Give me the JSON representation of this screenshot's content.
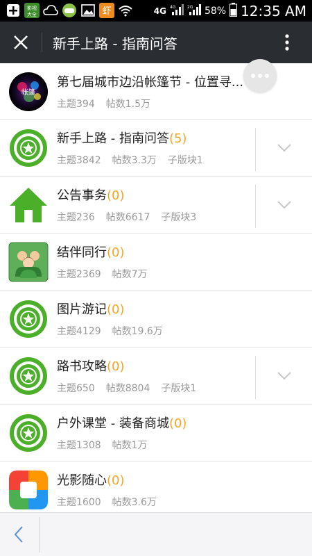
{
  "status_bar": {
    "app_icon_1": "影视大全",
    "signal_label": "4G",
    "network_1": "4G",
    "network_2": "2G",
    "battery": "58%",
    "time": "12:35 AM"
  },
  "header": {
    "title": "新手上路 - 指南问答"
  },
  "forums": [
    {
      "name": "第七届城市边沿帐篷节 - 位置寻...",
      "count": "",
      "topics": "主题394",
      "posts": "帖数1.5万",
      "sub": "",
      "icon": "festival-avatar",
      "expandable": false
    },
    {
      "name": "新手上路 - 指南问答",
      "count": "(5)",
      "topics": "主题3842",
      "posts": "帖数3.3万",
      "sub": "子版块1",
      "icon": "green-star-badge",
      "expandable": true
    },
    {
      "name": "公告事务",
      "count": "(0)",
      "topics": "主题236",
      "posts": "帖数6617",
      "sub": "子版块3",
      "icon": "green-house",
      "expandable": true
    },
    {
      "name": "结伴同行",
      "count": "(0)",
      "topics": "主题2369",
      "posts": "帖数7万",
      "sub": "",
      "icon": "group-people",
      "expandable": false
    },
    {
      "name": "图片游记",
      "count": "(0)",
      "topics": "主题4129",
      "posts": "帖数19.6万",
      "sub": "",
      "icon": "green-star-badge",
      "expandable": false
    },
    {
      "name": "路书攻略",
      "count": "(0)",
      "topics": "主题650",
      "posts": "帖数8804",
      "sub": "子版块1",
      "icon": "green-star-badge",
      "expandable": true
    },
    {
      "name": "户外课堂 - 装备商城",
      "count": "(0)",
      "topics": "主题1308",
      "posts": "帖数1万",
      "sub": "",
      "icon": "green-star-badge",
      "expandable": false
    },
    {
      "name": "光影随心",
      "count": "(0)",
      "topics": "主题1600",
      "posts": "帖数3.6万",
      "sub": "",
      "icon": "photo-app",
      "expandable": false
    }
  ],
  "colors": {
    "topbar": "#2a2e33",
    "accent_count": "#f5a623",
    "badge_green": "#4caf2a"
  }
}
